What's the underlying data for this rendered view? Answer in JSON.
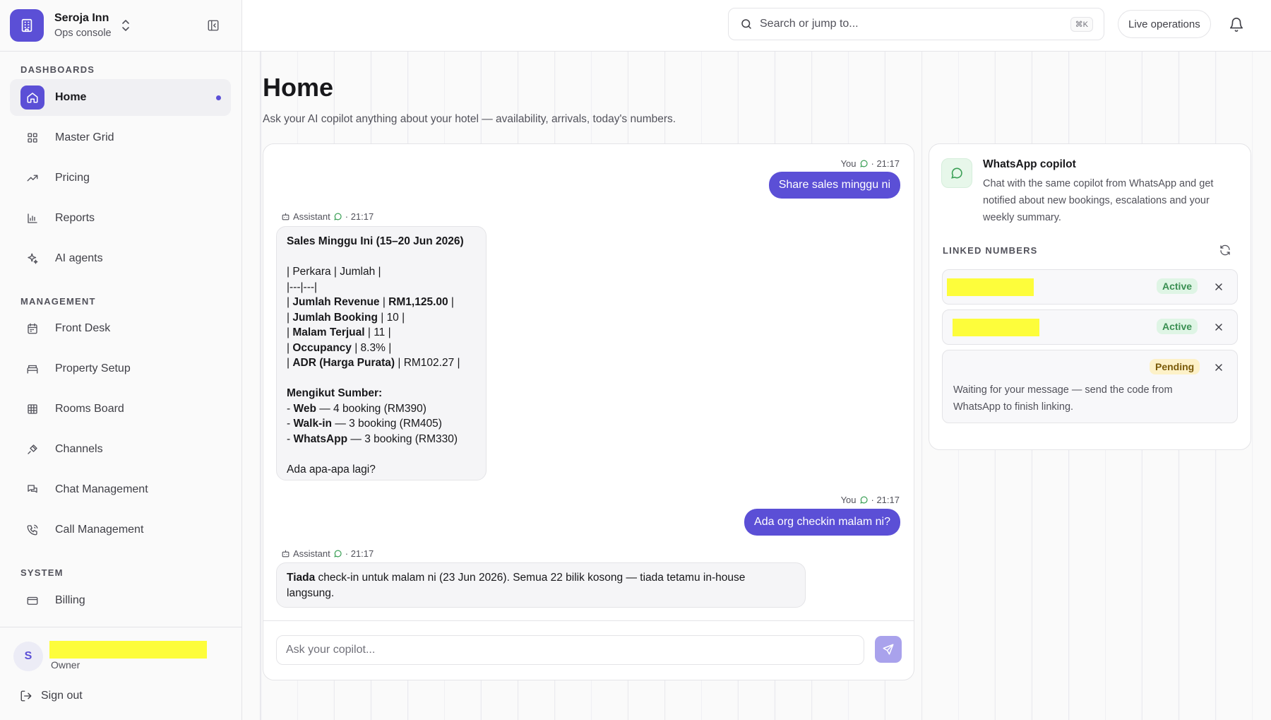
{
  "brand": {
    "name": "Seroja Inn",
    "subtitle": "Ops console"
  },
  "sidebar": {
    "sections": [
      {
        "label": "DASHBOARDS",
        "items": [
          {
            "label": "Home",
            "icon": "home-icon",
            "active": true
          },
          {
            "label": "Master Grid",
            "icon": "grid-icon"
          },
          {
            "label": "Pricing",
            "icon": "trend-up-icon"
          },
          {
            "label": "Reports",
            "icon": "bar-chart-icon"
          },
          {
            "label": "AI agents",
            "icon": "sparkles-icon"
          }
        ]
      },
      {
        "label": "MANAGEMENT",
        "items": [
          {
            "label": "Front Desk",
            "icon": "calendar-icon"
          },
          {
            "label": "Property Setup",
            "icon": "bed-icon"
          },
          {
            "label": "Rooms Board",
            "icon": "table-icon"
          },
          {
            "label": "Channels",
            "icon": "plug-icon"
          },
          {
            "label": "Chat Management",
            "icon": "chat-bubbles-icon"
          },
          {
            "label": "Call Management",
            "icon": "phone-icon"
          }
        ]
      },
      {
        "label": "SYSTEM",
        "items": [
          {
            "label": "Billing",
            "icon": "credit-card-icon"
          }
        ]
      }
    ]
  },
  "user": {
    "initial": "S",
    "role": "Owner",
    "signout_label": "Sign out"
  },
  "topbar": {
    "search_placeholder": "Search or jump to...",
    "search_shortcut": "⌘K",
    "live_label": "Live operations"
  },
  "page": {
    "title": "Home",
    "subtitle": "Ask your AI copilot anything about your hotel — availability, arrivals, today's numbers."
  },
  "chat": {
    "msg1": {
      "who": "You",
      "time": "· 21:17",
      "text": "Share sales minggu ni"
    },
    "msg2": {
      "who": "Assistant",
      "time": "· 21:17",
      "heading": "Sales Minggu Ini (15–20 Jun 2026)",
      "table_header": "| Perkara | Jumlah |",
      "table_sep": "|---|---|",
      "rows": [
        {
          "label": "Jumlah Revenue",
          "value": "RM1,125.00",
          "value_bold": true
        },
        {
          "label": "Jumlah Booking",
          "value": "10"
        },
        {
          "label": "Malam Terjual",
          "value": "11"
        },
        {
          "label": "Occupancy",
          "value": "8.3%"
        },
        {
          "label": "ADR (Harga Purata)",
          "value": "RM102.27"
        }
      ],
      "sources_heading": "Mengikut Sumber:",
      "sources": [
        {
          "label": "Web",
          "value": "— 4 booking (RM390)"
        },
        {
          "label": "Walk-in",
          "value": "— 3 booking (RM405)"
        },
        {
          "label": "WhatsApp",
          "value": "— 3 booking (RM330)"
        }
      ],
      "closing": "Ada apa-apa lagi?"
    },
    "msg3": {
      "who": "You",
      "time": "· 21:17",
      "text": "Ada org checkin malam ni?"
    },
    "msg4": {
      "who": "Assistant",
      "time": "· 21:17",
      "bold": "Tiada",
      "text": " check-in untuk malam ni (23 Jun 2026). Semua 22 bilik kosong — tiada tetamu in-house langsung."
    },
    "composer_placeholder": "Ask your copilot..."
  },
  "whatsapp": {
    "title": "WhatsApp copilot",
    "description": "Chat with the same copilot from WhatsApp and get notified about new bookings, escalations and your weekly summary.",
    "linked_label": "LINKED NUMBERS",
    "numbers": [
      {
        "status": "Active"
      },
      {
        "status": "Active"
      },
      {
        "status": "Pending",
        "note": "Waiting for your message — send the code from WhatsApp to finish linking."
      }
    ]
  },
  "colors": {
    "accent": "#5b4fd6",
    "active_badge": "#dff5e5",
    "pending_badge": "#fdf1c8",
    "redaction": "#fdfd3b"
  }
}
